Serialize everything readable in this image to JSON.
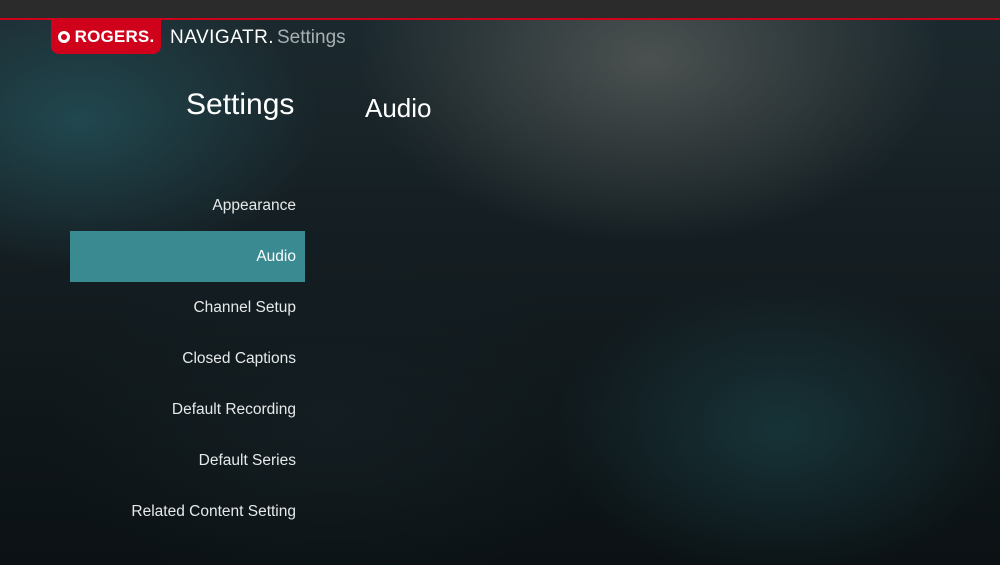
{
  "header": {
    "brand_logo_text": "ROGERS.",
    "brand_title": "NAVIGATR.",
    "breadcrumb": "Settings"
  },
  "page": {
    "title": "Settings",
    "section_title": "Audio"
  },
  "menu": {
    "items": [
      {
        "label": "Appearance",
        "selected": false
      },
      {
        "label": "Audio",
        "selected": true
      },
      {
        "label": "Channel Setup",
        "selected": false
      },
      {
        "label": "Closed Captions",
        "selected": false
      },
      {
        "label": "Default Recording",
        "selected": false
      },
      {
        "label": "Default Series",
        "selected": false
      },
      {
        "label": "Related Content Setting",
        "selected": false
      }
    ]
  },
  "colors": {
    "brand_red": "#d0021b",
    "selection_teal": "#3a8a92"
  }
}
